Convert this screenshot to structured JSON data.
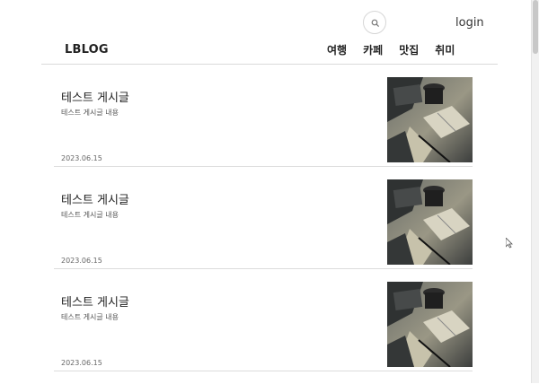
{
  "header": {
    "login_label": "login",
    "search_icon": "search-icon",
    "logo_text": "LBLOG"
  },
  "nav": {
    "items": [
      {
        "label": "여행"
      },
      {
        "label": "카페"
      },
      {
        "label": "맛집"
      },
      {
        "label": "취미"
      }
    ]
  },
  "posts": [
    {
      "title": "테스트 게시글",
      "excerpt": "테스트 게시글 내용",
      "date": "2023.06.15",
      "thumbnail_icon": "desk-photo-thumbnail"
    },
    {
      "title": "테스트 게시글",
      "excerpt": "테스트 게시글 내용",
      "date": "2023.06.15",
      "thumbnail_icon": "desk-photo-thumbnail"
    },
    {
      "title": "테스트 게시글",
      "excerpt": "테스트 게시글 내용",
      "date": "2023.06.15",
      "thumbnail_icon": "desk-photo-thumbnail"
    }
  ],
  "colors": {
    "background": "#ffffff",
    "text": "#222222",
    "divider": "#d9d9d9",
    "thumbnail_dark": "#3a3d3d",
    "thumbnail_light": "#b8b49e"
  }
}
